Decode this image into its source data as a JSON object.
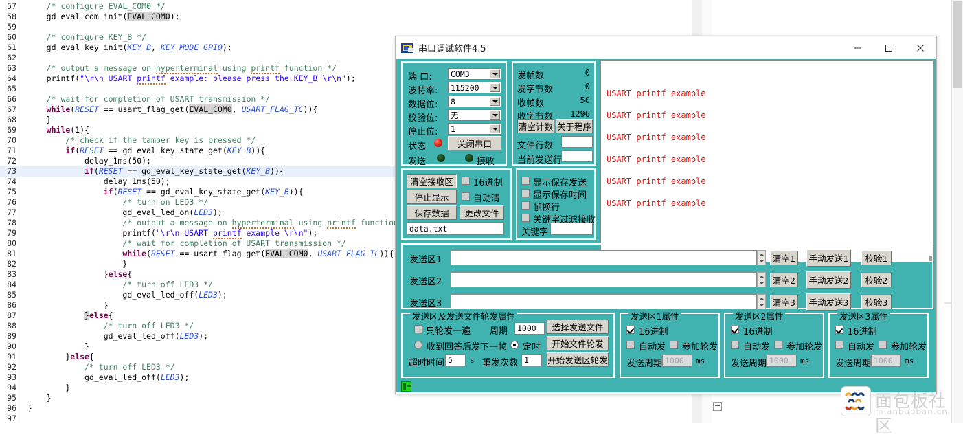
{
  "editor": {
    "lines": [
      {
        "n": "57",
        "indent": 4,
        "html": "<span class='cm'>/* configure EVAL_COM0 */</span>"
      },
      {
        "n": "58",
        "indent": 4,
        "html": "gd_eval_com_init(<span class='mk'>EVAL_COM0</span>);"
      },
      {
        "n": "59",
        "indent": 0,
        "html": ""
      },
      {
        "n": "60",
        "indent": 4,
        "html": "<span class='cm'>/* configure KEY_B */</span>"
      },
      {
        "n": "61",
        "indent": 4,
        "html": "gd_eval_key_init(<span class='ty'>KEY_B</span>, <span class='ty'>KEY_MODE_GPIO</span>);"
      },
      {
        "n": "62",
        "indent": 0,
        "html": ""
      },
      {
        "n": "63",
        "indent": 4,
        "html": "<span class='cm'>/* output a message on <span class='sq'>hyperterminal</span> using <span class='sq'>printf</span> function */</span>"
      },
      {
        "n": "64",
        "indent": 4,
        "html": "printf(<span class='st'>\"\\r\\n USART <span class='sq'>printf</span> example: please press the KEY_B \\r\\n\"</span>);"
      },
      {
        "n": "65",
        "indent": 0,
        "html": ""
      },
      {
        "n": "66",
        "indent": 4,
        "html": "<span class='cm'>/* wait for completion of USART transmission */</span>"
      },
      {
        "n": "67",
        "indent": 4,
        "html": "<span class='kw'>while</span>(<span class='ty'>RESET</span> == usart_flag_get(<span class='mk'>EVAL_COM0</span>, <span class='ty'>USART_FLAG_TC</span>)){"
      },
      {
        "n": "68",
        "indent": 4,
        "html": "}"
      },
      {
        "n": "69",
        "indent": 4,
        "html": "<span class='kw'>while</span>(1){"
      },
      {
        "n": "70",
        "indent": 8,
        "html": "<span class='cm'>/* check if the tamper key is pressed */</span>"
      },
      {
        "n": "71",
        "indent": 8,
        "html": "<span class='kw'>if</span>(<span class='ty'>RESET</span> == gd_eval_key_state_get(<span class='ty'>KEY_B</span>)){"
      },
      {
        "n": "72",
        "indent": 12,
        "html": "delay_1ms(50);"
      },
      {
        "n": "73",
        "indent": 12,
        "html": "<span class='kw'>if</span>(<span class='ty'>RESET</span> == gd_eval_key_state_get(<span class='ty'>KEY_B</span>)){",
        "hl": true
      },
      {
        "n": "74",
        "indent": 16,
        "html": "delay_1ms(50);"
      },
      {
        "n": "75",
        "indent": 16,
        "html": "<span class='kw'>if</span>(<span class='ty'>RESET</span> == gd_eval_key_state_get(<span class='ty'>KEY_B</span>)){"
      },
      {
        "n": "76",
        "indent": 20,
        "html": "<span class='cm'>/* turn on LED3 */</span>"
      },
      {
        "n": "77",
        "indent": 20,
        "html": "gd_eval_led_on(<span class='ty'>LED3</span>);"
      },
      {
        "n": "78",
        "indent": 20,
        "html": "<span class='cm'>/* output a message on <span class='sq'>hyperterminal</span> using <span class='sq'>printf</span> function</span>"
      },
      {
        "n": "79",
        "indent": 20,
        "html": "printf(<span class='st'>\"\\r\\n USART <span class='sq'>printf</span> example \\r\\n\"</span>);"
      },
      {
        "n": "80",
        "indent": 20,
        "html": "<span class='cm'>/* wait for completion of USART transmission */</span>"
      },
      {
        "n": "81",
        "indent": 20,
        "html": "<span class='kw'>while</span>(<span class='ty'>RESET</span> == usart_flag_get(<span class='mk'>EVAL_COM0</span>, <span class='ty'>USART_FLAG_TC</span>)){"
      },
      {
        "n": "82",
        "indent": 20,
        "html": "}"
      },
      {
        "n": "83",
        "indent": 16,
        "html": "}<span class='kw'>else</span>{"
      },
      {
        "n": "84",
        "indent": 20,
        "html": "<span class='cm'>/* turn off LED3 */</span>"
      },
      {
        "n": "85",
        "indent": 20,
        "html": "gd_eval_led_off(<span class='ty'>LED3</span>);"
      },
      {
        "n": "86",
        "indent": 16,
        "html": "}"
      },
      {
        "n": "87",
        "indent": 12,
        "html": "<span class='mk'>}</span><span class='kw'>else</span>{"
      },
      {
        "n": "88",
        "indent": 16,
        "html": "<span class='cm'>/* turn off LED3 */</span>"
      },
      {
        "n": "89",
        "indent": 16,
        "html": "gd_eval_led_off(<span class='ty'>LED3</span>);"
      },
      {
        "n": "90",
        "indent": 12,
        "html": "}"
      },
      {
        "n": "91",
        "indent": 8,
        "html": "}<span class='kw'>else</span>{"
      },
      {
        "n": "92",
        "indent": 12,
        "html": "<span class='cm'>/* turn off LED3 */</span>"
      },
      {
        "n": "93",
        "indent": 12,
        "html": "gd_eval_led_off(<span class='ty'>LED3</span>);"
      },
      {
        "n": "94",
        "indent": 8,
        "html": "}"
      },
      {
        "n": "95",
        "indent": 4,
        "html": "}"
      },
      {
        "n": "96",
        "indent": 0,
        "html": "}"
      },
      {
        "n": "97",
        "indent": 0,
        "html": ""
      }
    ]
  },
  "window": {
    "title": "串口调试软件4.5",
    "minimize_label": "—",
    "maximize_label": "□",
    "close_label": "✕"
  },
  "port_settings": {
    "labels": {
      "port": "端  口:",
      "baud": "波特率:",
      "data_bits": "数据位:",
      "parity": "校验位:",
      "stop_bits": "停止位:",
      "status": "状态",
      "send": "发送",
      "receive": "接收"
    },
    "values": {
      "port": "COM3",
      "baud": "115200",
      "data_bits": "8",
      "parity": "无",
      "stop_bits": "1"
    },
    "toggle_button": "关闭串口",
    "status_color": "#e01f10"
  },
  "stats": {
    "rows": [
      {
        "label": "发帧数",
        "value": "0"
      },
      {
        "label": "发字节数",
        "value": "0"
      },
      {
        "label": "收帧数",
        "value": "50"
      },
      {
        "label": "收字节数",
        "value": "1296"
      }
    ],
    "clear_counter_button": "清空计数",
    "about_button": "关于程序",
    "file_lines_label": "文件行数",
    "file_lines_value": "",
    "current_send_line_label": "当前发送行",
    "current_send_line_value": ""
  },
  "recv_controls": {
    "clear_recv_button": "清空接收区",
    "stop_display_button": "停止显示",
    "save_data_button": "保存数据",
    "change_file_button": "更改文件",
    "hex_checkbox": "16进制",
    "autoclear_checkbox": "自动清",
    "filename": "data.txt"
  },
  "display_options": {
    "items": [
      {
        "label": "显示保存发送",
        "checked": false
      },
      {
        "label": "显示保存时间",
        "checked": false
      },
      {
        "label": "帧换行",
        "checked": false
      },
      {
        "label": "关键字过滤接收",
        "checked": false
      }
    ],
    "keyword_label": "关键字",
    "keyword_value": ""
  },
  "receive_area": {
    "text_color": "#ee1111",
    "lines": [
      "USART printf example",
      "USART printf example",
      "USART printf example",
      "USART printf example",
      "USART printf example",
      "USART printf example"
    ]
  },
  "send_areas": [
    {
      "label": "发送区1",
      "value": "",
      "clear": "清空1",
      "manual": "手动发送1",
      "check": "校验1"
    },
    {
      "label": "发送区2",
      "value": "",
      "clear": "清空2",
      "manual": "手动发送2",
      "check": "校验2"
    },
    {
      "label": "发送区3",
      "value": "",
      "clear": "清空3",
      "manual": "手动发送3",
      "check": "校验3"
    }
  ],
  "loop_props": {
    "caption": "发送区及发送文件轮发属性",
    "once_checkbox": "只轮发一遍",
    "once_checked": false,
    "period_label": "周期",
    "period_value": "1000",
    "period_unit": "ms",
    "after_reply_radio": "收到回答后发下一帧",
    "after_reply_selected": false,
    "timed_radio": "定时",
    "timed_selected": true,
    "timeout_label": "超时时间",
    "timeout_value": "5",
    "timeout_unit": "s",
    "resend_label": "重发次数",
    "resend_value": "1",
    "select_file_button": "选择发送文件",
    "start_file_loop_button": "开始文件轮发",
    "start_area_loop_button": "开始发送区轮发"
  },
  "area_props": [
    {
      "caption": "发送区1属性",
      "hex": "16进制",
      "hex_checked": true,
      "auto": "自动发",
      "auto_checked": false,
      "join": "参加轮发",
      "join_checked": false,
      "period_label": "发送周期",
      "period_value": "1000",
      "period_unit": "ms"
    },
    {
      "caption": "发送区2属性",
      "hex": "16进制",
      "hex_checked": true,
      "auto": "自动发",
      "auto_checked": false,
      "join": "参加轮发",
      "join_checked": false,
      "period_label": "发送周期",
      "period_value": "1000",
      "period_unit": "ms"
    },
    {
      "caption": "发送区3属性",
      "hex": "16进制",
      "hex_checked": true,
      "auto": "自动发",
      "auto_checked": false,
      "join": "参加轮发",
      "join_checked": false,
      "period_label": "发送周期",
      "period_value": "1000",
      "period_unit": "ms"
    }
  ],
  "watermark": {
    "title": "面包板社区",
    "subtitle": "mianbaoban.cn"
  },
  "theme": {
    "client_bg": "#40b3b0",
    "button_face": "#d8d5cd"
  }
}
